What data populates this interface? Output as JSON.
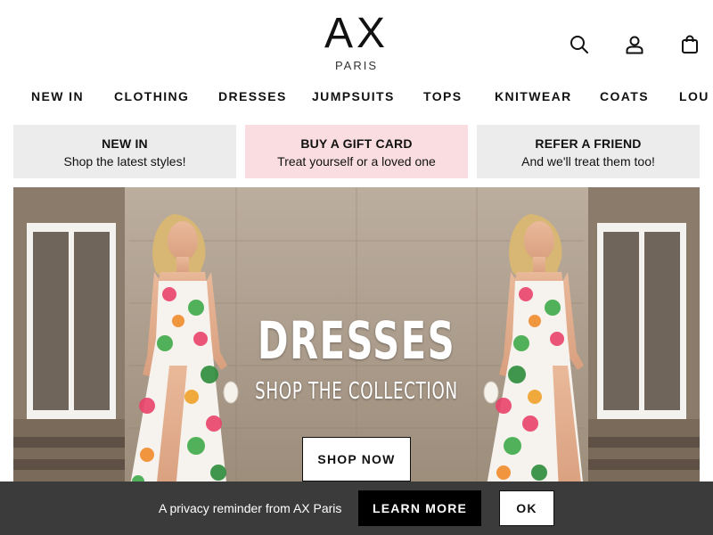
{
  "header": {
    "logo_main": "AX",
    "logo_sub": "PARIS",
    "icons": [
      "search-icon",
      "account-icon",
      "bag-icon"
    ]
  },
  "nav": {
    "items": [
      "NEW IN",
      "CLOTHING",
      "DRESSES",
      "JUMPSUITS",
      "TOPS",
      "KNITWEAR",
      "COATS",
      "LOU"
    ]
  },
  "promos": [
    {
      "title": "NEW IN",
      "subtitle": "Shop the latest styles!"
    },
    {
      "title": "BUY A GIFT CARD",
      "subtitle": "Treat yourself or a loved one"
    },
    {
      "title": "REFER A FRIEND",
      "subtitle": "And we'll treat them too!"
    }
  ],
  "hero": {
    "title": "DRESSES",
    "subtitle": "SHOP THE COLLECTION",
    "button": "SHOP NOW"
  },
  "cookie": {
    "text": "A privacy reminder from AX Paris",
    "learn_more": "LEARN MORE",
    "ok": "OK"
  },
  "colors": {
    "promo_grey": "#ececec",
    "promo_pink": "#fadde1",
    "cookie_bar": "#3b3b3b",
    "text": "#111111"
  }
}
